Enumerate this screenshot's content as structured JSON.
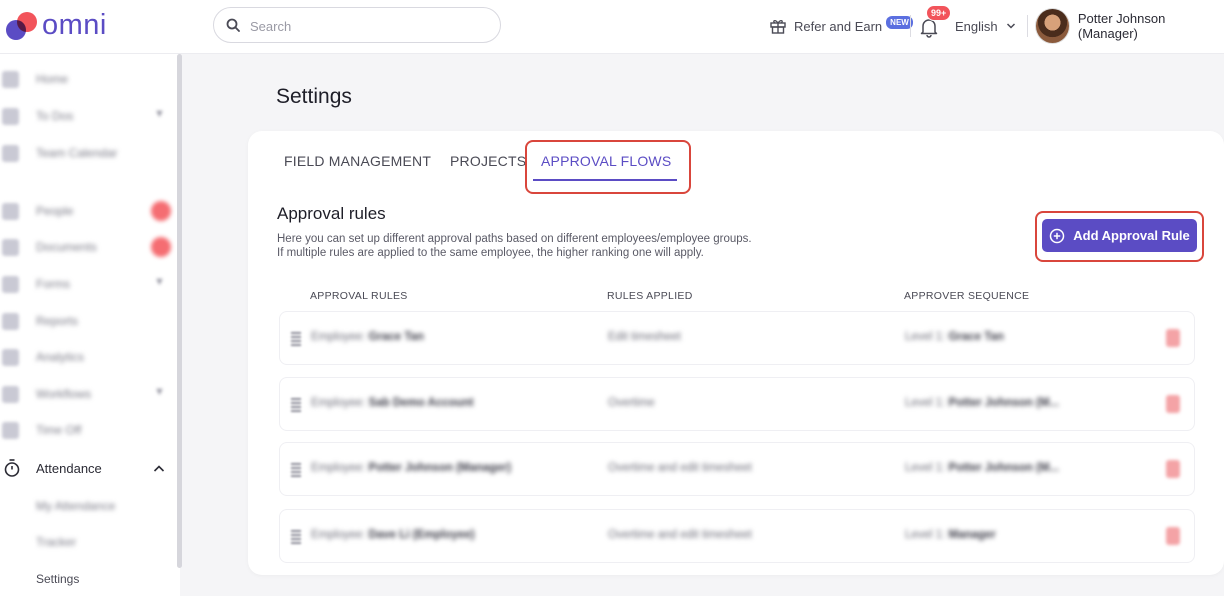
{
  "header": {
    "logo_text": "omni",
    "search_placeholder": "Search",
    "refer_label": "Refer and Earn",
    "refer_badge": "NEW",
    "notification_count": "99+",
    "language": "English",
    "user_name": "Potter Johnson (Manager)"
  },
  "sidebar": {
    "items": [
      {
        "label": "Home"
      },
      {
        "label": "To Dos"
      },
      {
        "label": "Team Calendar"
      },
      {
        "label": "People"
      },
      {
        "label": "Documents"
      },
      {
        "label": "Forms"
      },
      {
        "label": "Reports"
      },
      {
        "label": "Analytics"
      },
      {
        "label": "Workflows"
      },
      {
        "label": "Time Off"
      }
    ],
    "attendance": {
      "label": "Attendance",
      "subitems": [
        "My Attendance",
        "Tracker",
        "Settings"
      ]
    }
  },
  "main": {
    "page_title": "Settings",
    "tabs": [
      "FIELD MANAGEMENT",
      "PROJECTS",
      "APPROVAL FLOWS"
    ],
    "active_tab": "APPROVAL FLOWS",
    "section_title": "Approval rules",
    "description_line1": "Here you can set up different approval paths based on different employees/employee groups.",
    "description_line2": "If multiple rules are applied to the same employee, the higher ranking one will apply.",
    "add_button_label": "Add Approval Rule",
    "columns": [
      "APPROVAL RULES",
      "RULES APPLIED",
      "APPROVER SEQUENCE"
    ],
    "rows": [
      {
        "rule_prefix": "Employee:",
        "rule_name": "Grace Tan",
        "applied": "Edit timesheet",
        "seq_prefix": "Level 1:",
        "seq_name": "Grace Tan"
      },
      {
        "rule_prefix": "Employee:",
        "rule_name": "Sab Demo Account",
        "applied": "Overtime",
        "seq_prefix": "Level 1:",
        "seq_name": "Potter Johnson (M..."
      },
      {
        "rule_prefix": "Employee:",
        "rule_name": "Potter Johnson (Manager)",
        "applied": "Overtime and edit timesheet",
        "seq_prefix": "Level 1:",
        "seq_name": "Potter Johnson (M..."
      },
      {
        "rule_prefix": "Employee:",
        "rule_name": "Dave Li (Employee)",
        "applied": "Overtime and edit timesheet",
        "seq_prefix": "Level 1:",
        "seq_name": "Manager"
      }
    ]
  }
}
